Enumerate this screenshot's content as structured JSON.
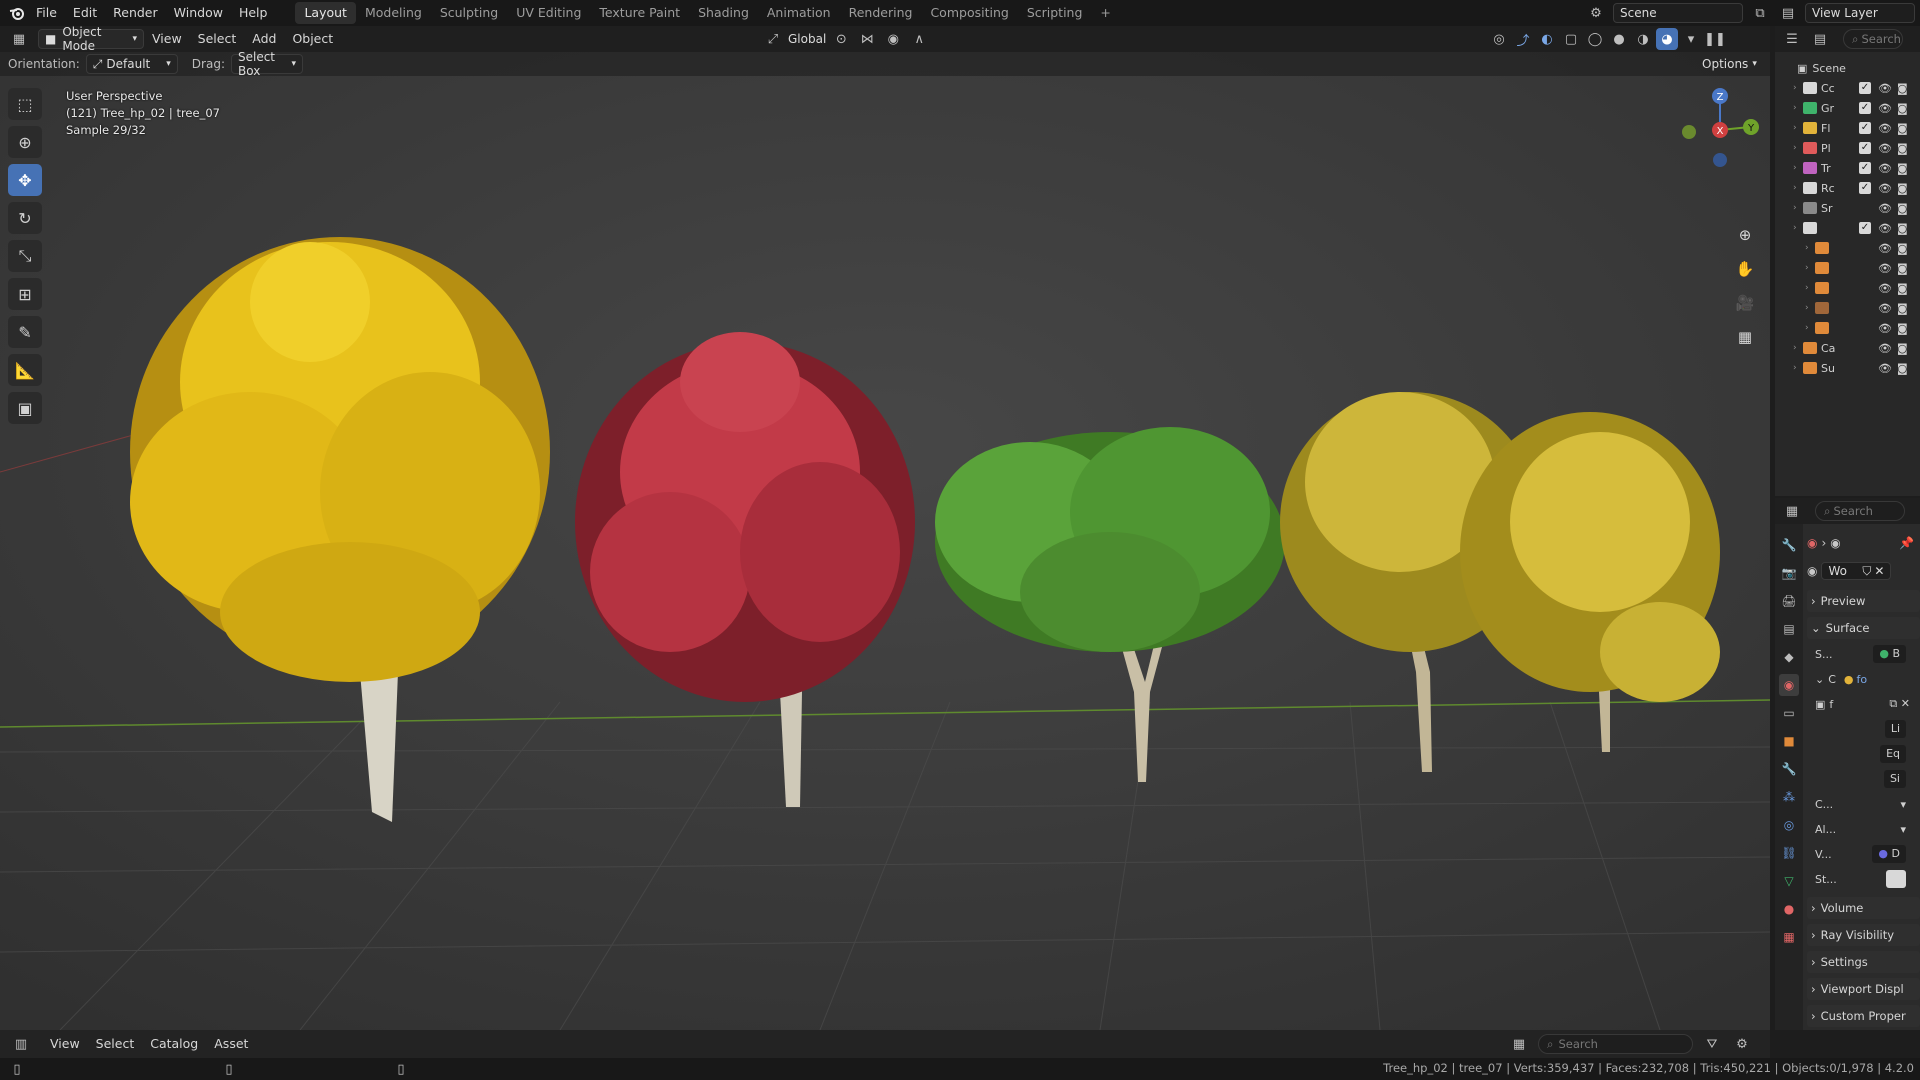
{
  "topbar": {
    "menus": [
      "File",
      "Edit",
      "Render",
      "Window",
      "Help"
    ],
    "workspace_tabs": [
      "Layout",
      "Modeling",
      "Sculpting",
      "UV Editing",
      "Texture Paint",
      "Shading",
      "Animation",
      "Rendering",
      "Compositing",
      "Scripting"
    ],
    "active_tab": "Layout",
    "add_tab": "+",
    "scene_name": "Scene",
    "view_layer": "View Layer"
  },
  "viewport_header": {
    "mode": "Object Mode",
    "menus": [
      "View",
      "Select",
      "Add",
      "Object"
    ],
    "transform_orientation": "Global"
  },
  "tool_header": {
    "orientation_label": "Orientation:",
    "orientation_value": "Default",
    "drag_label": "Drag:",
    "drag_value": "Select Box",
    "options_label": "Options"
  },
  "overlay": {
    "view_name": "User Perspective",
    "object_info": "(121) Tree_hp_02 | tree_07",
    "sample": "Sample 29/32"
  },
  "gizmo": {
    "z": "Z",
    "x": "X",
    "y": "Y"
  },
  "toolbar_tools": [
    "select-box",
    "cursor",
    "move",
    "rotate",
    "scale",
    "transform",
    "annotate",
    "measure",
    "add-cube"
  ],
  "outliner": {
    "search_placeholder": "Search",
    "root": "Scene",
    "rows": [
      {
        "label": "Cc",
        "color": "#d8d8d8",
        "checked": true
      },
      {
        "label": "Gr",
        "color": "#3fb36b",
        "checked": true
      },
      {
        "label": "Fl",
        "color": "#e2b33a",
        "checked": true
      },
      {
        "label": "Pl",
        "color": "#e05b5b",
        "checked": true
      },
      {
        "label": "Tr",
        "color": "#c064c0",
        "checked": true
      },
      {
        "label": "Rc",
        "color": "#d8d8d8",
        "checked": true
      },
      {
        "label": "Sr",
        "color": "#8a8a8a",
        "checked": false
      },
      {
        "label": "",
        "color": "#d8d8d8",
        "checked": true
      },
      {
        "label": "",
        "color": "#e08a3a",
        "checked": false
      },
      {
        "label": "",
        "color": "#e08a3a",
        "checked": false
      },
      {
        "label": "",
        "color": "#e08a3a",
        "checked": false
      },
      {
        "label": "",
        "color": "#a0673a",
        "checked": false
      },
      {
        "label": "",
        "color": "#e08a3a",
        "checked": false
      },
      {
        "label": "Ca",
        "color": "#e08a3a",
        "checked": false
      },
      {
        "label": "Su",
        "color": "#e08a3a",
        "checked": false
      }
    ]
  },
  "properties": {
    "search_placeholder": "Search",
    "world_name": "Wo",
    "panels": {
      "preview": "Preview",
      "surface": "Surface",
      "surface_field": "S...",
      "surface_value": "B",
      "color_label": "C",
      "color_value": "fo",
      "image_label": "f",
      "li": "Li",
      "eq": "Eq",
      "si": "Si",
      "c_label": "C...",
      "al_label": "Al...",
      "v_label": "V...",
      "v_value": "D",
      "st_label": "St...",
      "volume": "Volume",
      "ray_visibility": "Ray Visibility",
      "settings": "Settings",
      "viewport_display": "Viewport Displ",
      "custom_properties": "Custom Proper"
    }
  },
  "asset_bar": {
    "menus": [
      "View",
      "Select",
      "Catalog",
      "Asset"
    ],
    "search_placeholder": "Search"
  },
  "status_bar": {
    "text": "Tree_hp_02 | tree_07 | Verts:359,437 | Faces:232,708 | Tris:450,221 | Objects:0/1,978 | 4.2.0"
  },
  "colors": {
    "accent": "#4672b5",
    "tree_yellow": "#e8c21c",
    "tree_red": "#c23a48",
    "tree_green": "#5aa33a",
    "tree_olive": "#cdb63a"
  }
}
